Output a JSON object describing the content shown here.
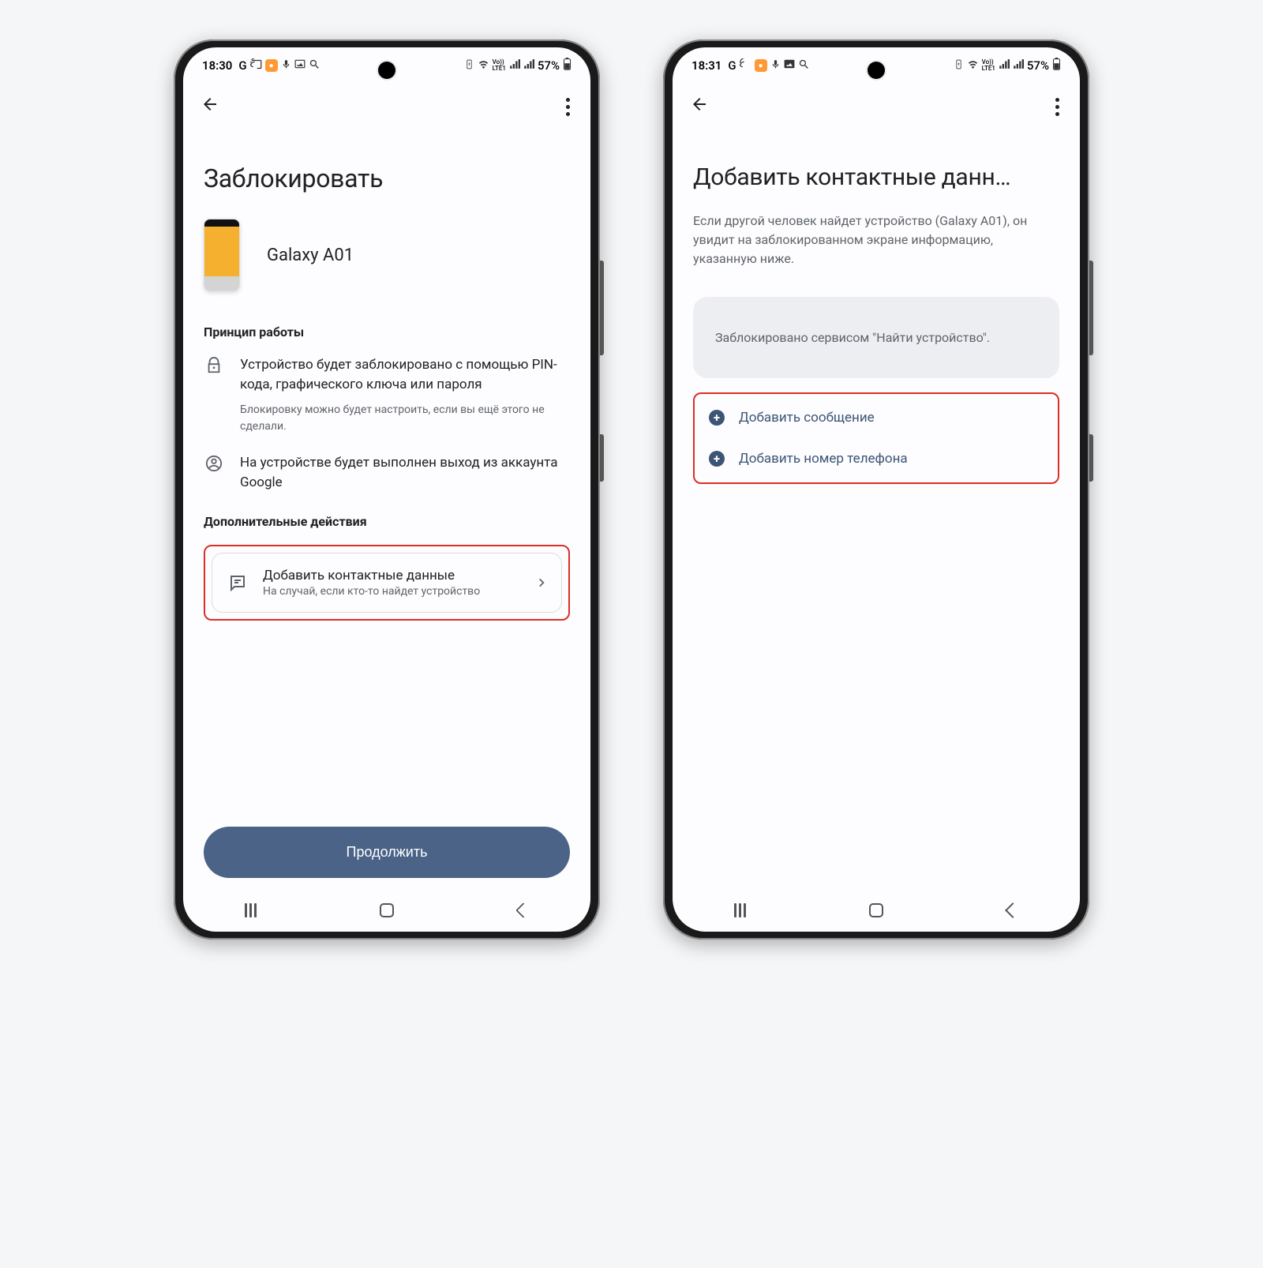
{
  "left": {
    "status": {
      "time": "18:30",
      "battery": "57%"
    },
    "title": "Заблокировать",
    "device_name": "Galaxy A01",
    "how_it_works_heading": "Принцип работы",
    "item_lock": "Устройство будет заблокировано с помощью PIN-кода, графического ключа или пароля",
    "item_lock_sub": "Блокировку можно будет настроить, если вы ещё этого не сделали.",
    "item_signout": "На устройстве будет выполнен выход из аккаунта Google",
    "additional_heading": "Дополнительные действия",
    "card_title": "Добавить контактные данные",
    "card_sub": "На случай, если кто-то найдет устройство",
    "continue_label": "Продолжить"
  },
  "right": {
    "status": {
      "time": "18:31",
      "battery": "57%"
    },
    "title": "Добавить контактные данн…",
    "desc": "Если другой человек найдет устройство (Galaxy A01), он увидит на заблокированном экране информацию, указанную ниже.",
    "locked_msg": "Заблокировано сервисом \"Найти устройство\".",
    "add_message": "Добавить сообщение",
    "add_phone": "Добавить номер телефона"
  }
}
